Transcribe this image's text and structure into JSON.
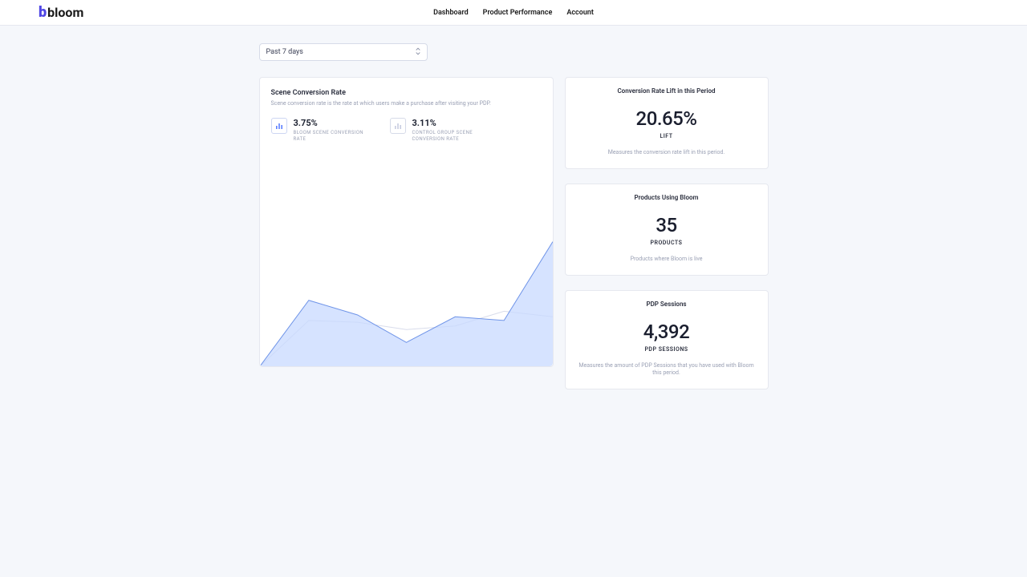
{
  "brand": "bloom",
  "nav": {
    "dashboard": "Dashboard",
    "product_performance": "Product Performance",
    "account": "Account"
  },
  "filter": {
    "selected": "Past 7 days"
  },
  "chart_card": {
    "title": "Scene Conversion Rate",
    "subtitle": "Scene conversion rate is the rate at which users make a purchase after visiting your PDP.",
    "metric_a": {
      "value": "3.75%",
      "label": "BLOOM SCENE CONVERSION RATE"
    },
    "metric_b": {
      "value": "3.11%",
      "label": "CONTROL GROUP SCENE CONVERSION RATE"
    }
  },
  "stats": {
    "lift": {
      "title": "Conversion Rate Lift in this Period",
      "value": "20.65%",
      "unit": "LIFT",
      "desc": "Measures the conversion rate lift in this period."
    },
    "products": {
      "title": "Products Using Bloom",
      "value": "35",
      "unit": "PRODUCTS",
      "desc": "Products where Bloom is live"
    },
    "sessions": {
      "title": "PDP Sessions",
      "value": "4,392",
      "unit": "PDP SESSIONS",
      "desc": "Measures the amount of PDP Sessions that you have used with Bloom this period."
    }
  },
  "chart_data": {
    "type": "area",
    "x": [
      0,
      1,
      2,
      3,
      4,
      5,
      6
    ],
    "series": [
      {
        "name": "Bloom Scene Conversion Rate",
        "values": [
          0.0,
          3.6,
          2.8,
          1.3,
          2.7,
          2.5,
          6.8
        ],
        "color": "#8fb3ff"
      },
      {
        "name": "Control Group Conversion Rate",
        "values": [
          0.0,
          2.5,
          2.4,
          2.0,
          2.2,
          3.0,
          2.7
        ],
        "color": "#d8dceb"
      }
    ],
    "ylim": [
      0,
      7
    ],
    "xlabel": "",
    "ylabel": ""
  },
  "colors": {
    "accent": "#4f46e5",
    "area_fill": "#c8d9ff",
    "area_stroke": "#6f94e8",
    "control_stroke": "#d8dceb"
  }
}
